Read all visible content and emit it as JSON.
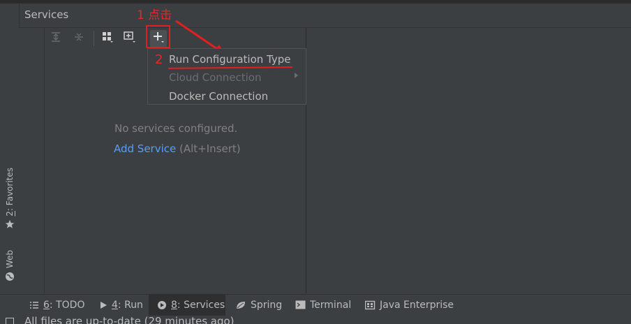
{
  "panel": {
    "title": "Services"
  },
  "annotations": {
    "step1": "1 点击",
    "step2": "2"
  },
  "popup_menu": {
    "items": [
      {
        "label": "Run Configuration Type",
        "state": "enabled"
      },
      {
        "label": "Cloud Connection",
        "state": "disabled",
        "has_submenu": true
      },
      {
        "label": "Docker Connection",
        "state": "enabled"
      }
    ]
  },
  "empty_state": {
    "message": "No services configured.",
    "add_link": "Add Service",
    "shortcut": "(Alt+Insert)"
  },
  "left_stripe": {
    "favorites": {
      "num": "2",
      "label": ": Favorites"
    },
    "web": "Web"
  },
  "tool_windows": [
    {
      "num": "6",
      "label": ": TODO",
      "icon": "list-icon",
      "active": false
    },
    {
      "num": "4",
      "label": ": Run",
      "icon": "play-icon",
      "active": false
    },
    {
      "num": "8",
      "label": ": Services",
      "icon": "services-icon",
      "active": true
    },
    {
      "label": "Spring",
      "icon": "spring-leaf-icon",
      "active": false
    },
    {
      "label": "Terminal",
      "icon": "terminal-icon",
      "active": false
    },
    {
      "label": "Java Enterprise",
      "icon": "java-enterprise-icon",
      "active": false
    }
  ],
  "status_bar": {
    "text": "All files are up-to-date (29 minutes ago)"
  },
  "colors": {
    "accent_link": "#589df6",
    "annotation": "#e02020",
    "background": "#3c3f41"
  }
}
